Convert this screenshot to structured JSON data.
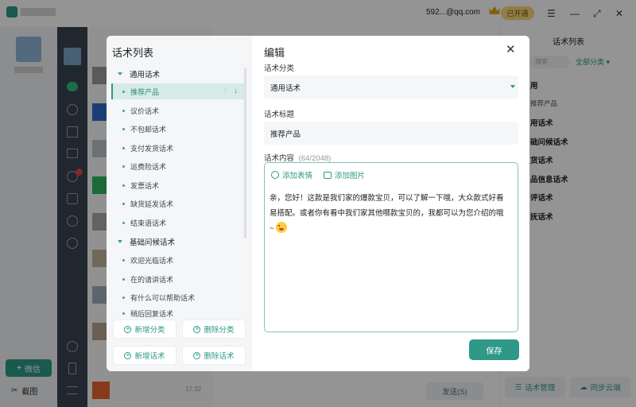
{
  "colors": {
    "accent": "#2e9986",
    "accent_light": "#d6ebe7",
    "dark_sidebar": "#3a4450",
    "overlay": "rgba(0,0,0,0.42)"
  },
  "topbar": {
    "account": "592...@qq.com",
    "vip_badge": "已开通"
  },
  "bg_right": {
    "title": "话术列表",
    "search_placeholder": "搜索",
    "filter": "全部分类",
    "items": [
      "用",
      "推荐产品",
      "用话术",
      "础问候话术",
      "货话术",
      "品信息话术",
      "评话术",
      "抚话术"
    ],
    "btn_manage": "话术管理",
    "btn_sync": "同步云端"
  },
  "bg_left": {
    "wechat_button": "微信",
    "screenshot_label": "截图",
    "chat_time": "17:32",
    "send_button": "发送(S)"
  },
  "modal": {
    "left": {
      "title": "话术列表",
      "categories": [
        {
          "label": "通用话术",
          "items": [
            "推荐产品",
            "议价话术",
            "不包邮话术",
            "支付发货话术",
            "运费险话术",
            "发票话术",
            "缺货延发话术",
            "结束语话术"
          ]
        },
        {
          "label": "基础问候话术",
          "items": [
            "欢迎光临话术",
            "在的请讲话术",
            "有什么可以帮助话术",
            "稍后回复话术"
          ]
        }
      ],
      "btn_add_category": "新增分类",
      "btn_delete_category": "删除分类",
      "btn_add_script": "新增话术",
      "btn_delete_script": "删除话术"
    },
    "right": {
      "title": "编辑",
      "category_label": "话术分类",
      "category_value": "通用话术",
      "title_label": "话术标题",
      "title_value": "推荐产品",
      "content_label": "话术内容",
      "content_count": "(64/2048)",
      "tool_emoji": "添加表情",
      "tool_image": "添加图片",
      "content_text": "亲，您好！这款是我们家的爆款宝贝，可以了解一下哦，大众款式好看易搭配。或者你有看中我们家其他哪款宝贝的，我都可以为您介绍的哦~",
      "save_button": "保存"
    }
  }
}
